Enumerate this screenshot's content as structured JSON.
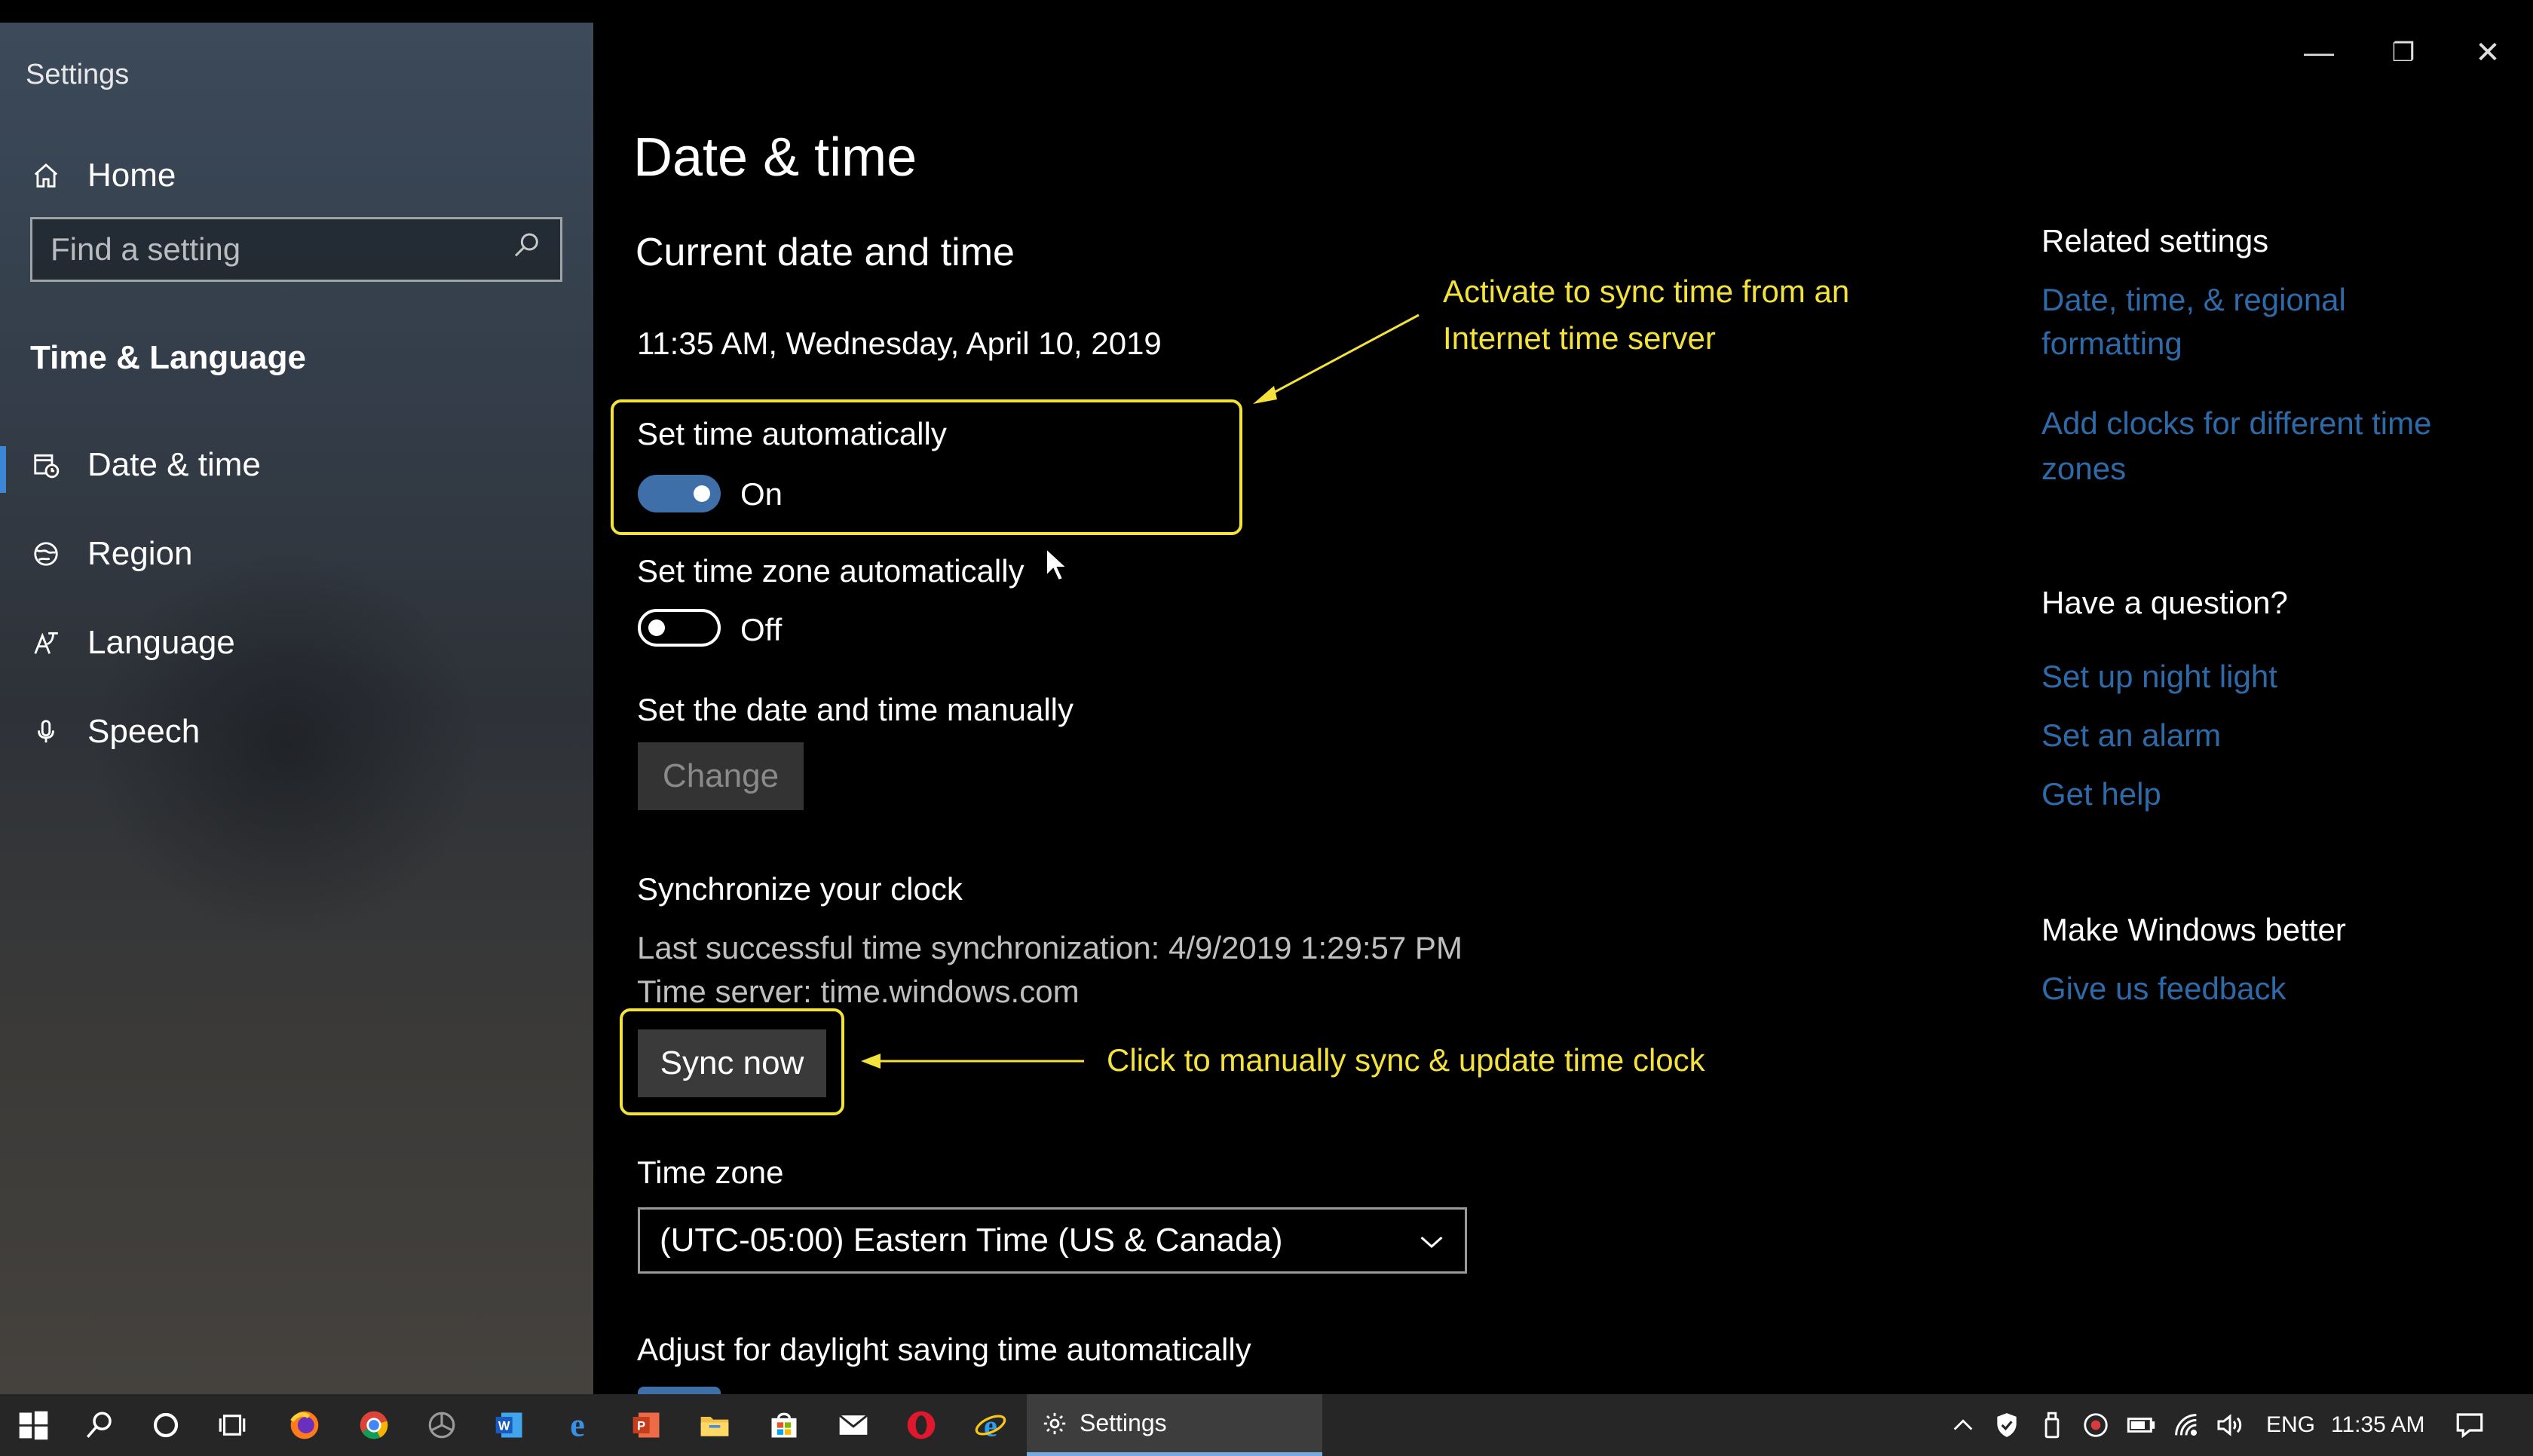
{
  "window": {
    "title": "Settings",
    "controls": {
      "minimize": "—",
      "restore": "❐",
      "close": "✕"
    }
  },
  "sidebar": {
    "home_label": "Home",
    "search_placeholder": "Find a setting",
    "section": "Time & Language",
    "items": [
      {
        "label": "Date & time",
        "icon": "calendar-clock-icon",
        "active": true
      },
      {
        "label": "Region",
        "icon": "globe-icon",
        "active": false
      },
      {
        "label": "Language",
        "icon": "language-icon",
        "active": false
      },
      {
        "label": "Speech",
        "icon": "microphone-icon",
        "active": false
      }
    ]
  },
  "main": {
    "page_title": "Date & time",
    "current_heading": "Current date and time",
    "current_value": "11:35 AM, Wednesday, April 10, 2019",
    "set_time_auto": {
      "label": "Set time automatically",
      "state": "On"
    },
    "set_zone_auto": {
      "label": "Set time zone automatically",
      "state": "Off"
    },
    "manual": {
      "label": "Set the date and time manually",
      "button": "Change"
    },
    "sync": {
      "heading": "Synchronize your clock",
      "last_sync": "Last successful time synchronization: 4/9/2019 1:29:57 PM",
      "server": "Time server: time.windows.com",
      "button": "Sync now"
    },
    "time_zone": {
      "label": "Time zone",
      "value": "(UTC-05:00) Eastern Time (US & Canada)"
    },
    "dst_label": "Adjust for daylight saving time automatically"
  },
  "annotations": {
    "auto_sync_line1": "Activate to sync time from an",
    "auto_sync_line2": "Internet time server",
    "manual_sync": "Click to manually sync & update time clock",
    "color": "#f3e23c"
  },
  "related": {
    "heading": "Related settings",
    "link1_line1": "Date, time, & regional",
    "link1_line2": "formatting",
    "link2_line1": "Add clocks for different time",
    "link2_line2": "zones",
    "question_heading": "Have a question?",
    "q_links": [
      "Set up night light",
      "Set an alarm",
      "Get help"
    ],
    "better_heading": "Make Windows better",
    "feedback": "Give us feedback",
    "link_color": "#2e6aa8"
  },
  "taskbar": {
    "active_task": "Settings",
    "language": "ENG",
    "time": "11:35 AM"
  }
}
